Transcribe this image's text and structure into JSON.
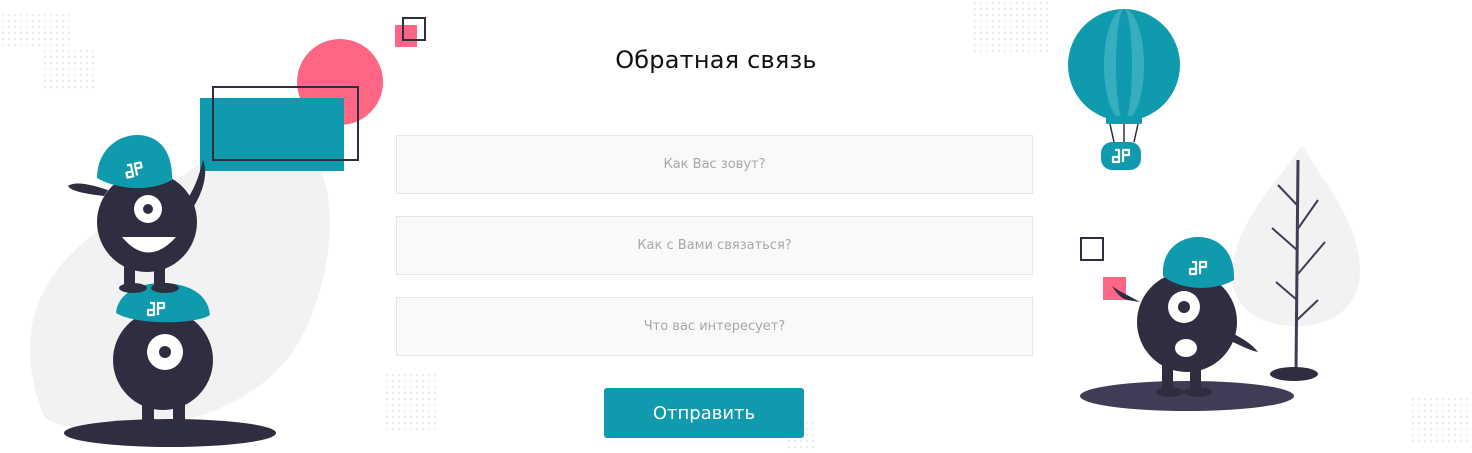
{
  "form": {
    "title": "Обратная связь",
    "fields": [
      {
        "placeholder": "Как Вас зовут?",
        "value": ""
      },
      {
        "placeholder": "Как с Вами связаться?",
        "value": ""
      },
      {
        "placeholder": "Что вас интересует?",
        "value": ""
      }
    ],
    "submit_label": "Отправить"
  },
  "colors": {
    "accent": "#0f9aae",
    "pink": "#ff6584",
    "dark": "#2f2e41",
    "light_gray": "#f2f2f2"
  },
  "icons": [
    "brand-logo-icon",
    "hot-air-balloon-icon",
    "tree-icon",
    "monster-character-icon"
  ]
}
